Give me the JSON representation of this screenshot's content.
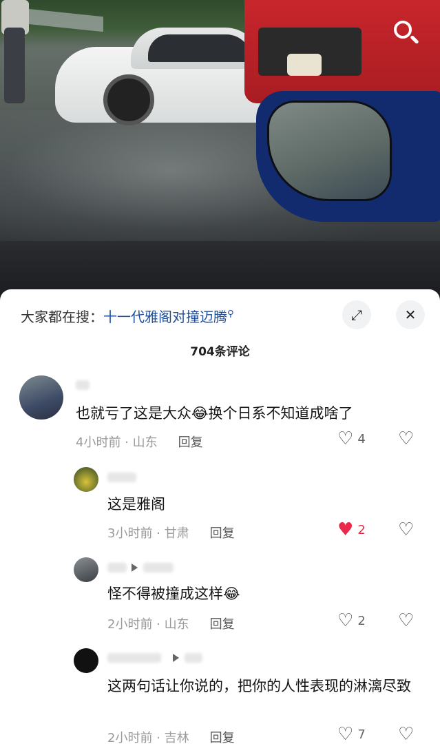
{
  "top": {
    "search_icon": "search-icon"
  },
  "sheet": {
    "search_prefix": "大家都在搜：",
    "search_link": "十一代雅阁对撞迈腾",
    "search_link_icon": "search-icon",
    "expand_icon": "⤢",
    "close_icon": "✕",
    "comment_count": "704条评论"
  },
  "comments": [
    {
      "text": "也就亏了这是大众😂换个日系不知道成啥了",
      "time": "4小时前 · 山东",
      "reply": "回复",
      "likes": "4",
      "liked": false
    },
    {
      "text": "这是雅阁",
      "time": "3小时前 · 甘肃",
      "reply": "回复",
      "likes": "2",
      "liked": true
    },
    {
      "text": "怪不得被撞成这样😂",
      "time": "2小时前 · 山东",
      "reply": "回复",
      "likes": "2",
      "liked": false
    },
    {
      "text": "这两句话让你说的，把你的人性表现的淋漓尽致",
      "time": "2小时前 · 吉林",
      "reply": "回复",
      "likes": "7",
      "liked": false
    }
  ],
  "colors": {
    "link": "#1f4f9a",
    "like_active": "#ea2a4a"
  }
}
